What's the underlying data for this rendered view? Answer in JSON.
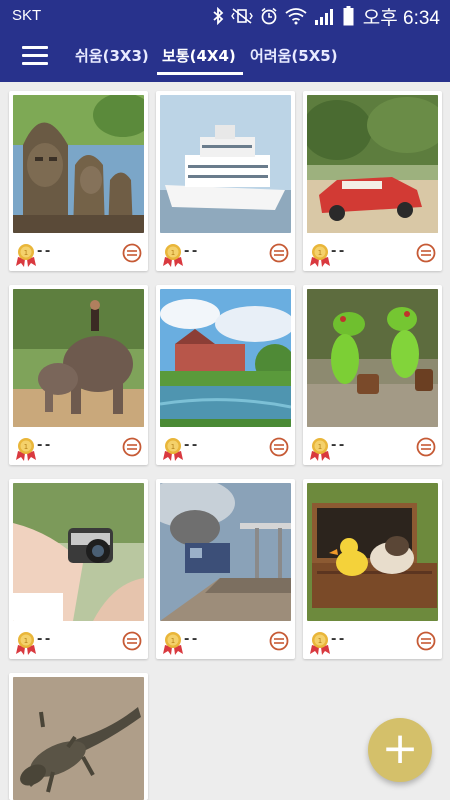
{
  "status_bar": {
    "carrier": "SKT",
    "time": "오후 6:34"
  },
  "tabs": [
    {
      "label": "쉬움(3X3)"
    },
    {
      "label": "보통(4X4)",
      "selected": true
    },
    {
      "label": "어려움(5X5)"
    }
  ],
  "colors": {
    "app_bar": "#28328c",
    "fab": "#d4c06a",
    "coin": "#c65a35",
    "medal_ribbon": "#d9393f",
    "medal_gold": "#e9b63a"
  },
  "puzzles": [
    {
      "subject": "Buddha face statues",
      "score": "- -"
    },
    {
      "subject": "Cruise ship",
      "score": "- -"
    },
    {
      "subject": "Red classic car",
      "score": "- -"
    },
    {
      "subject": "Elephants with rider",
      "score": "- -"
    },
    {
      "subject": "River with castle",
      "score": "- -"
    },
    {
      "subject": "Frog figurines",
      "score": "- -"
    },
    {
      "subject": "Hands with camera",
      "score": "- -"
    },
    {
      "subject": "Steam train at station",
      "score": "- -"
    },
    {
      "subject": "Suitcase with cat and duck",
      "score": "- -"
    },
    {
      "subject": "Iguana",
      "score": "- -"
    }
  ],
  "fab": {
    "icon": "plus-icon"
  }
}
